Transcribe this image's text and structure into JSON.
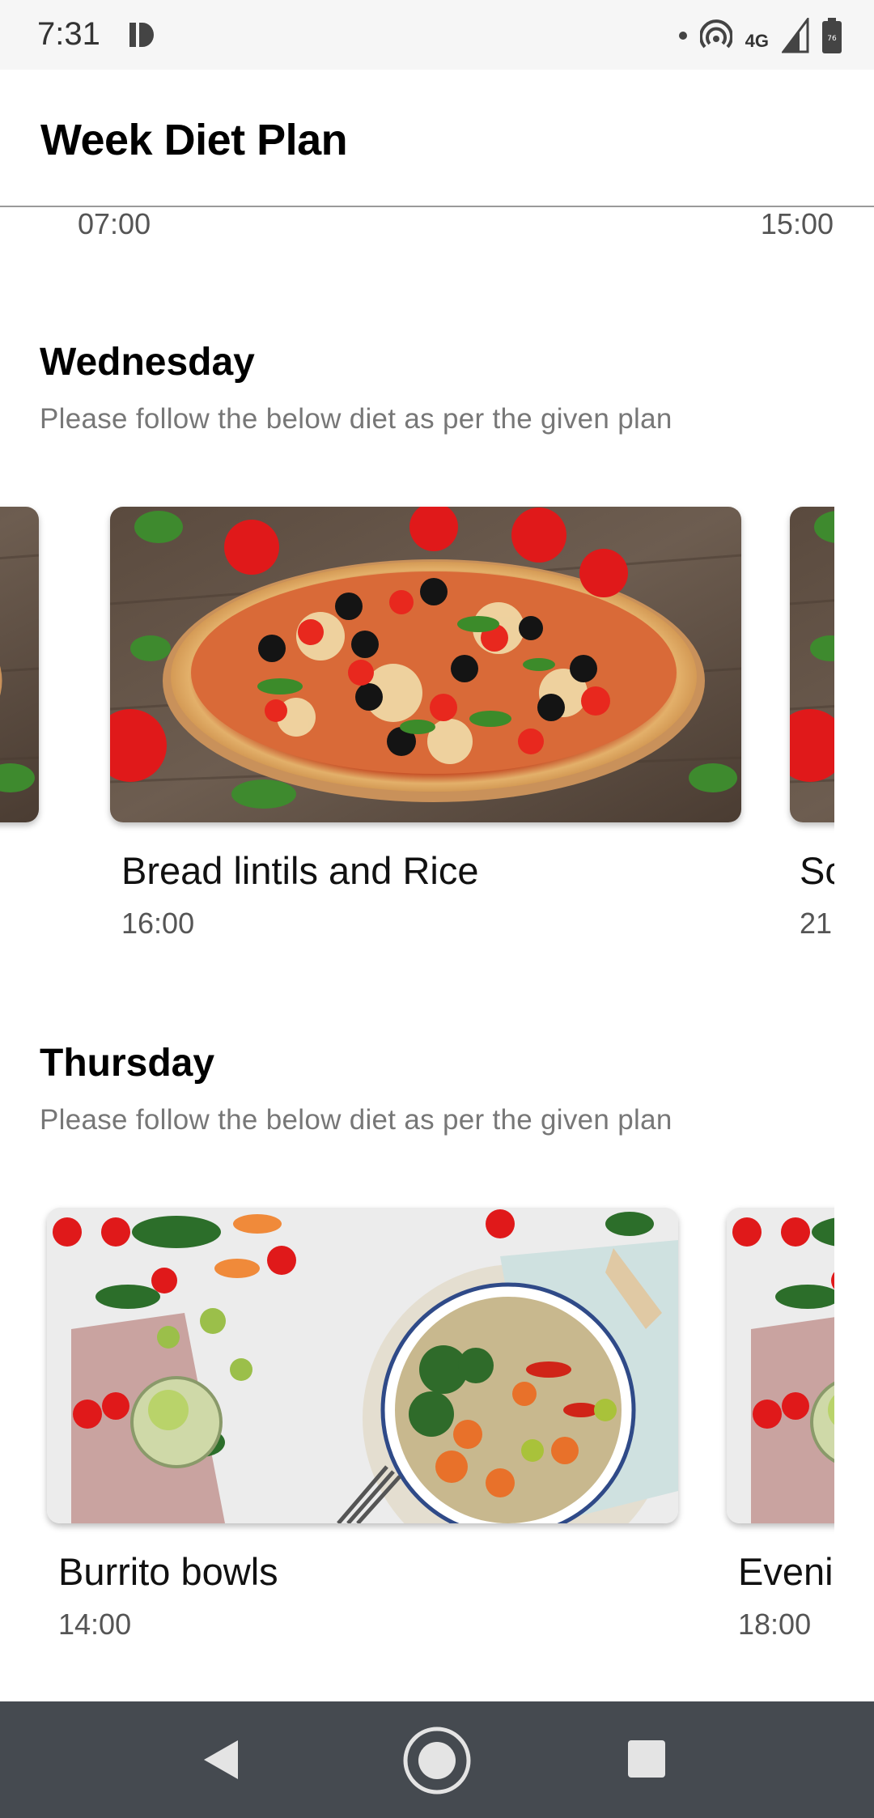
{
  "status_bar": {
    "time": "7:31",
    "network": "4G",
    "battery": "76"
  },
  "app_bar": {
    "title": "Week Diet Plan"
  },
  "prev_day": {
    "left_time": "07:00",
    "right_time": "15:00"
  },
  "days": [
    {
      "title": "Wednesday",
      "subtitle": "Please follow the below diet as per the given plan",
      "meals": [
        {
          "name": "Bread lintils and Rice",
          "time": "16:00",
          "image": "pizza-image"
        },
        {
          "name": "Sc",
          "time": "21",
          "image": "pizza-image"
        }
      ]
    },
    {
      "title": "Thursday",
      "subtitle": "Please follow the below diet as per the given plan",
      "meals": [
        {
          "name": "Burrito bowls",
          "time": "14:00",
          "image": "veggie-bowl-image"
        },
        {
          "name": "Eveni",
          "time": "18:00",
          "image": "veggie-bowl-image"
        }
      ]
    }
  ],
  "nav_bar": {
    "icons": [
      "back-icon",
      "home-icon",
      "recents-icon"
    ]
  }
}
